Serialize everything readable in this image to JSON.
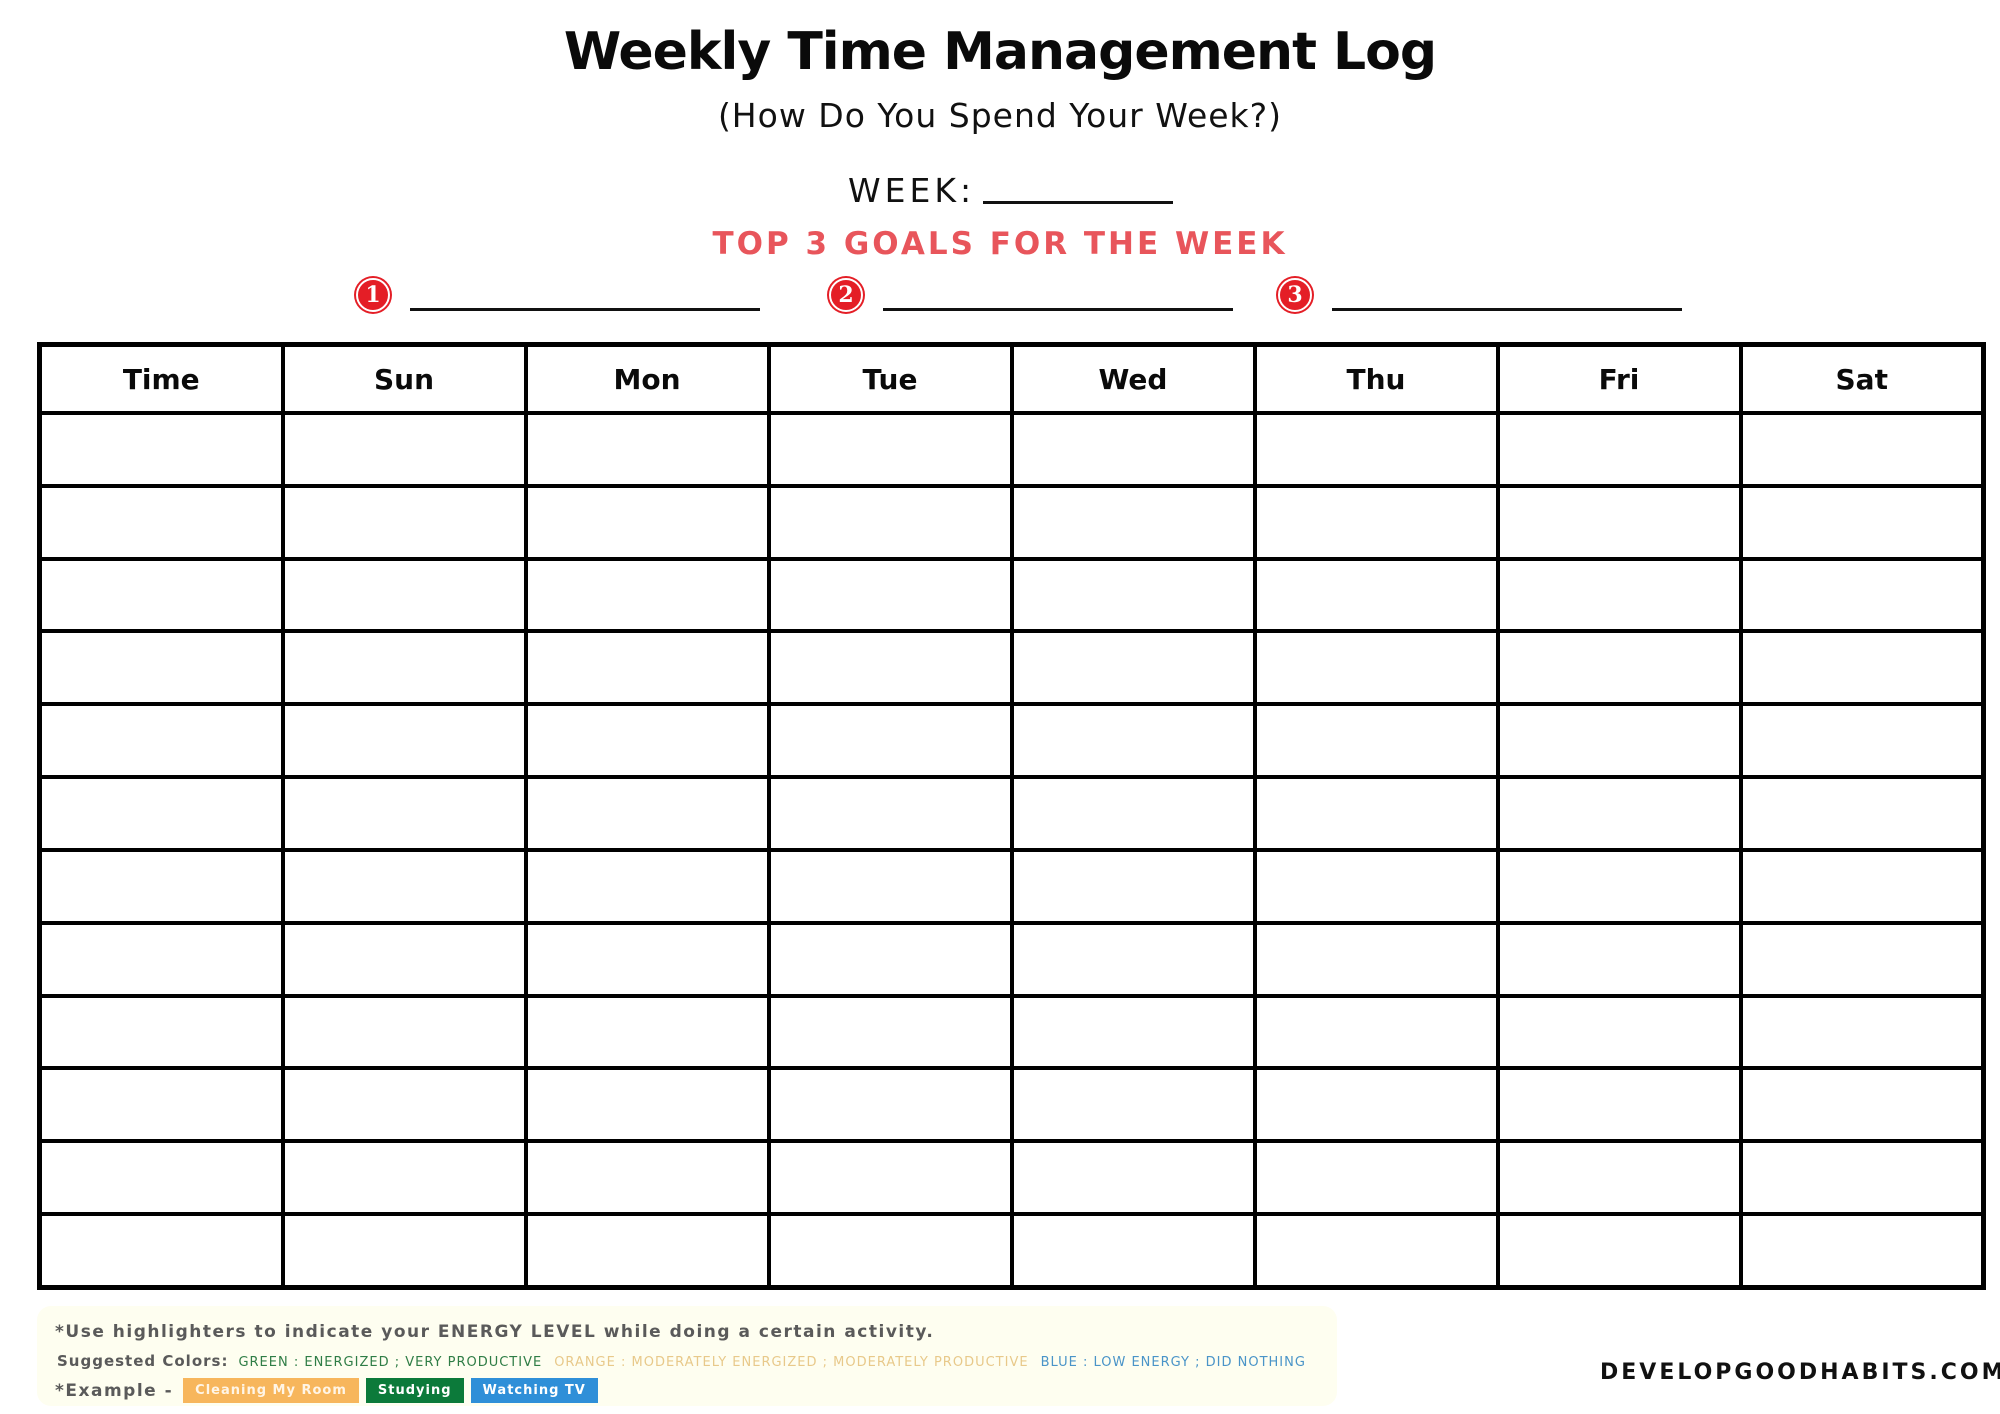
{
  "header": {
    "title": "Weekly Time Management Log",
    "subtitle": "(How Do You Spend Your Week?)",
    "week_label": "WEEK:",
    "week_value": ""
  },
  "goals": {
    "heading": "TOP 3 GOALS FOR THE WEEK",
    "items": [
      {
        "number": "1",
        "icon": "number-1-badge-icon",
        "value": ""
      },
      {
        "number": "2",
        "icon": "number-2-badge-icon",
        "value": ""
      },
      {
        "number": "3",
        "icon": "number-3-badge-icon",
        "value": ""
      }
    ],
    "badge_color": "#e41e26",
    "heading_color": "#e8555b"
  },
  "table": {
    "columns": [
      "Time",
      "Sun",
      "Mon",
      "Tue",
      "Wed",
      "Thu",
      "Fri",
      "Sat"
    ],
    "row_count": 12,
    "rows": [
      [
        "",
        "",
        "",
        "",
        "",
        "",
        "",
        ""
      ],
      [
        "",
        "",
        "",
        "",
        "",
        "",
        "",
        ""
      ],
      [
        "",
        "",
        "",
        "",
        "",
        "",
        "",
        ""
      ],
      [
        "",
        "",
        "",
        "",
        "",
        "",
        "",
        ""
      ],
      [
        "",
        "",
        "",
        "",
        "",
        "",
        "",
        ""
      ],
      [
        "",
        "",
        "",
        "",
        "",
        "",
        "",
        ""
      ],
      [
        "",
        "",
        "",
        "",
        "",
        "",
        "",
        ""
      ],
      [
        "",
        "",
        "",
        "",
        "",
        "",
        "",
        ""
      ],
      [
        "",
        "",
        "",
        "",
        "",
        "",
        "",
        ""
      ],
      [
        "",
        "",
        "",
        "",
        "",
        "",
        "",
        ""
      ],
      [
        "",
        "",
        "",
        "",
        "",
        "",
        "",
        ""
      ],
      [
        "",
        "",
        "",
        "",
        "",
        "",
        "",
        ""
      ]
    ]
  },
  "notes": {
    "instruction": "*Use highlighters to indicate your ENERGY LEVEL while doing a certain activity.",
    "suggested_label": "Suggested Colors:",
    "suggested": {
      "green": "GREEN : ENERGIZED ; VERY PRODUCTIVE",
      "orange": "ORANGE : MODERATELY ENERGIZED ; MODERATELY PRODUCTIVE",
      "blue": "BLUE : LOW ENERGY ; DID NOTHING"
    },
    "example_label": "*Example -",
    "examples": [
      {
        "label": "Cleaning My Room",
        "color": "#f7b65c"
      },
      {
        "label": "Studying",
        "color": "#0c7a3a"
      },
      {
        "label": "Watching TV",
        "color": "#2f8fd8"
      }
    ]
  },
  "footer": {
    "site": "DEVELOPGOODHABITS.COM"
  }
}
